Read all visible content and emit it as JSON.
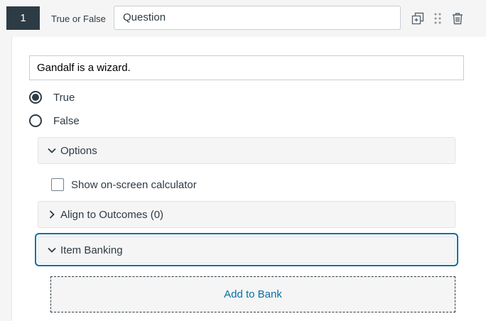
{
  "header": {
    "number": "1",
    "type_label": "True or False",
    "title_value": "Question",
    "icons": [
      "duplicate-icon",
      "drag-handle-icon",
      "trash-icon"
    ]
  },
  "question": {
    "stem": "Gandalf is a wizard.",
    "choices": [
      {
        "label": "True",
        "selected": true
      },
      {
        "label": "False",
        "selected": false
      }
    ]
  },
  "options": {
    "label": "Options",
    "expanded": true,
    "calculator_label": "Show on-screen calculator",
    "calculator_checked": false
  },
  "outcomes": {
    "label": "Align to Outcomes (0)",
    "expanded": false
  },
  "item_banking": {
    "label": "Item Banking",
    "expanded": true,
    "add_label": "Add to Bank"
  },
  "colors": {
    "dark": "#2d3b45",
    "link": "#0770a3",
    "border": "#c7cdd1"
  }
}
